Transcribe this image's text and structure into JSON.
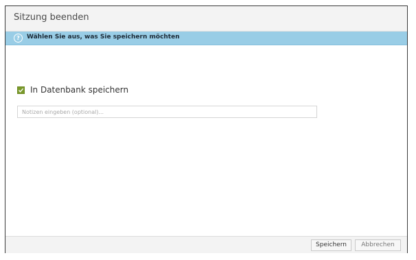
{
  "dialog": {
    "title": "Sitzung beenden",
    "info": {
      "icon": "help-circle-icon",
      "text": "Wählen Sie aus, was Sie speichern möchten"
    },
    "save_to_db": {
      "label": "In Datenbank speichern",
      "checked": true
    },
    "notes": {
      "value": "",
      "placeholder": "Notizen eingeben (optional)..."
    },
    "buttons": {
      "save": "Speichern",
      "cancel": "Abbrechen"
    }
  },
  "colors": {
    "info_bar": "#99cde6",
    "checkbox": "#7a9a2a"
  }
}
